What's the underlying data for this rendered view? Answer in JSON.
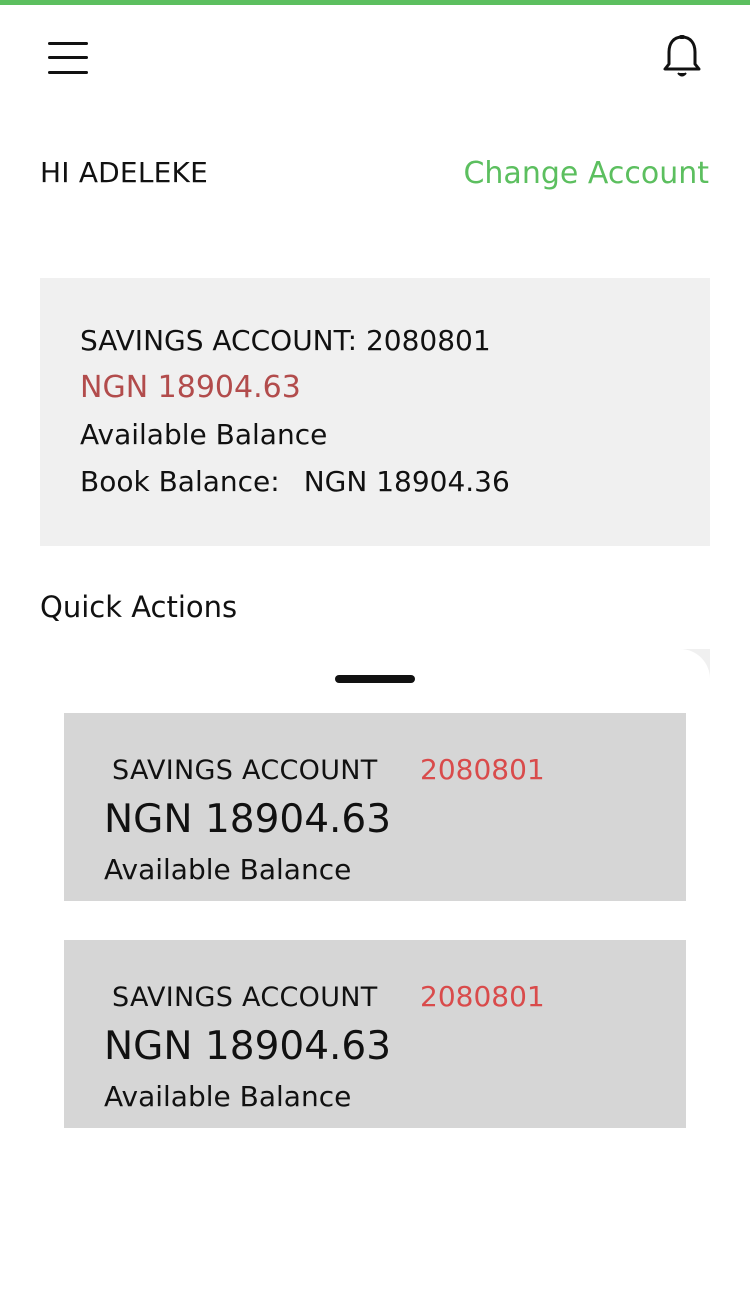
{
  "header": {
    "menu_icon": "hamburger-menu-icon",
    "bell_icon": "bell-icon",
    "accent_color": "#5cbf5f"
  },
  "greeting": "HI ADELEKE",
  "change_account_label": "Change Account",
  "account": {
    "title": "SAVINGS ACCOUNT: 2080801",
    "available_amount": "NGN 18904.63",
    "available_label": "Available Balance",
    "book_label": "Book Balance:",
    "book_value": "NGN 18904.36",
    "amount_color": "#b24c4c"
  },
  "quick_actions": {
    "title": "Quick Actions",
    "accounts": [
      {
        "type": "SAVINGS ACCOUNT",
        "number": "2080801",
        "amount": "NGN 18904.63",
        "label": "Available Balance"
      },
      {
        "type": "SAVINGS ACCOUNT",
        "number": "2080801",
        "amount": "NGN 18904.63",
        "label": "Available Balance"
      }
    ],
    "number_color": "#d94b4b"
  }
}
